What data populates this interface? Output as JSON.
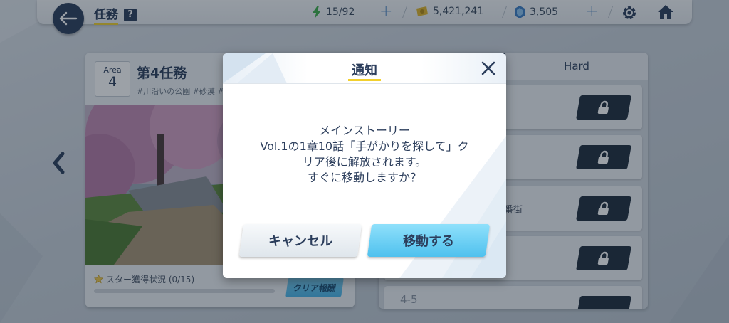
{
  "header": {
    "title": "任務",
    "help_label": "?",
    "stamina": "15/92",
    "coins": "5,421,241",
    "gems": "3,505"
  },
  "mission": {
    "area_label": "Area",
    "area_number": "4",
    "title": "第4任務",
    "tags": "#川沿いの公園 #砂漠 #砂",
    "star_status": "スター獲得状況 (0/15)",
    "clear_reward_label": "クリア報酬"
  },
  "right_panel": {
    "tab_hard": "Hard",
    "rows": [
      {
        "id": "",
        "text": ""
      },
      {
        "id": "",
        "text": ""
      },
      {
        "id": "",
        "text": "番街"
      },
      {
        "id": "",
        "text": ""
      },
      {
        "id": "4-5",
        "text": ""
      }
    ]
  },
  "dialog": {
    "title": "通知",
    "message_lines": [
      "メインストーリー",
      "Vol.1の1章10話「手がかりを探して」ク",
      "リア後に解放されます。",
      "すぐに移動しますか？"
    ],
    "cancel_label": "キャンセル",
    "confirm_label": "移動する"
  },
  "colors": {
    "navy": "#2c3e5c",
    "accent_yellow": "#f2d02e",
    "confirm_blue": "#4fc1ee",
    "stamina_green": "#3fae4a",
    "coin_gold": "#e0b62c",
    "gem_blue": "#3d7fc4"
  }
}
